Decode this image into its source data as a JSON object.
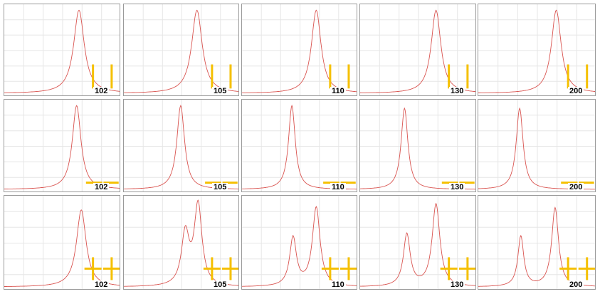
{
  "colors": {
    "curve": "#d9534f",
    "marker": "#f5c000",
    "grid": "#e6e6e6",
    "frame": "#9a9a9a"
  },
  "chart_data": [
    {
      "type": "line",
      "row": 1,
      "label": "102",
      "marker": "vertical-pair",
      "x": [
        0,
        1
      ],
      "ylim": [
        0,
        1
      ],
      "peaks": [
        {
          "x": 0.64,
          "height": 0.95,
          "width": 0.055
        }
      ]
    },
    {
      "type": "line",
      "row": 1,
      "label": "105",
      "marker": "vertical-pair",
      "x": [
        0,
        1
      ],
      "ylim": [
        0,
        1
      ],
      "peaks": [
        {
          "x": 0.63,
          "height": 0.95,
          "width": 0.055
        }
      ]
    },
    {
      "type": "line",
      "row": 1,
      "label": "110",
      "marker": "vertical-pair",
      "x": [
        0,
        1
      ],
      "ylim": [
        0,
        1
      ],
      "peaks": [
        {
          "x": 0.64,
          "height": 0.95,
          "width": 0.05
        }
      ]
    },
    {
      "type": "line",
      "row": 1,
      "label": "130",
      "marker": "vertical-pair",
      "x": [
        0,
        1
      ],
      "ylim": [
        0,
        1
      ],
      "peaks": [
        {
          "x": 0.65,
          "height": 0.95,
          "width": 0.05
        }
      ]
    },
    {
      "type": "line",
      "row": 1,
      "label": "200",
      "marker": "vertical-pair",
      "x": [
        0,
        1
      ],
      "ylim": [
        0,
        1
      ],
      "peaks": [
        {
          "x": 0.66,
          "height": 0.95,
          "width": 0.05
        }
      ]
    },
    {
      "type": "line",
      "row": 2,
      "label": "102",
      "marker": "horizontal-pair",
      "x": [
        0,
        1
      ],
      "ylim": [
        0,
        1
      ],
      "peaks": [
        {
          "x": 0.62,
          "height": 0.95,
          "width": 0.045
        }
      ]
    },
    {
      "type": "line",
      "row": 2,
      "label": "105",
      "marker": "horizontal-pair",
      "x": [
        0,
        1
      ],
      "ylim": [
        0,
        1
      ],
      "peaks": [
        {
          "x": 0.49,
          "height": 0.95,
          "width": 0.04
        }
      ]
    },
    {
      "type": "line",
      "row": 2,
      "label": "110",
      "marker": "horizontal-pair",
      "x": [
        0,
        1
      ],
      "ylim": [
        0,
        1
      ],
      "peaks": [
        {
          "x": 0.43,
          "height": 0.95,
          "width": 0.035
        }
      ]
    },
    {
      "type": "line",
      "row": 2,
      "label": "130",
      "marker": "horizontal-pair",
      "x": [
        0,
        1
      ],
      "ylim": [
        0,
        1
      ],
      "peaks": [
        {
          "x": 0.38,
          "height": 0.92,
          "width": 0.035
        }
      ]
    },
    {
      "type": "line",
      "row": 2,
      "label": "200",
      "marker": "horizontal-pair",
      "x": [
        0,
        1
      ],
      "ylim": [
        0,
        1
      ],
      "peaks": [
        {
          "x": 0.35,
          "height": 0.92,
          "width": 0.035
        }
      ]
    },
    {
      "type": "line",
      "row": 3,
      "label": "102",
      "marker": "cross-pair",
      "x": [
        0,
        1
      ],
      "ylim": [
        0,
        1
      ],
      "peaks": [
        {
          "x": 0.66,
          "height": 0.86,
          "width": 0.05
        }
      ]
    },
    {
      "type": "line",
      "row": 3,
      "label": "105",
      "marker": "cross-pair",
      "x": [
        0,
        1
      ],
      "ylim": [
        0,
        1
      ],
      "peaks": [
        {
          "x": 0.53,
          "height": 0.58,
          "width": 0.04
        },
        {
          "x": 0.64,
          "height": 0.9,
          "width": 0.04
        }
      ]
    },
    {
      "type": "line",
      "row": 3,
      "label": "110",
      "marker": "cross-pair",
      "x": [
        0,
        1
      ],
      "ylim": [
        0,
        1
      ],
      "peaks": [
        {
          "x": 0.44,
          "height": 0.54,
          "width": 0.035
        },
        {
          "x": 0.64,
          "height": 0.88,
          "width": 0.04
        }
      ]
    },
    {
      "type": "line",
      "row": 3,
      "label": "130",
      "marker": "cross-pair",
      "x": [
        0,
        1
      ],
      "ylim": [
        0,
        1
      ],
      "peaks": [
        {
          "x": 0.4,
          "height": 0.58,
          "width": 0.035
        },
        {
          "x": 0.65,
          "height": 0.92,
          "width": 0.04
        }
      ]
    },
    {
      "type": "line",
      "row": 3,
      "label": "200",
      "marker": "cross-pair",
      "x": [
        0,
        1
      ],
      "ylim": [
        0,
        1
      ],
      "peaks": [
        {
          "x": 0.36,
          "height": 0.56,
          "width": 0.03
        },
        {
          "x": 0.65,
          "height": 0.88,
          "width": 0.035
        }
      ]
    }
  ]
}
